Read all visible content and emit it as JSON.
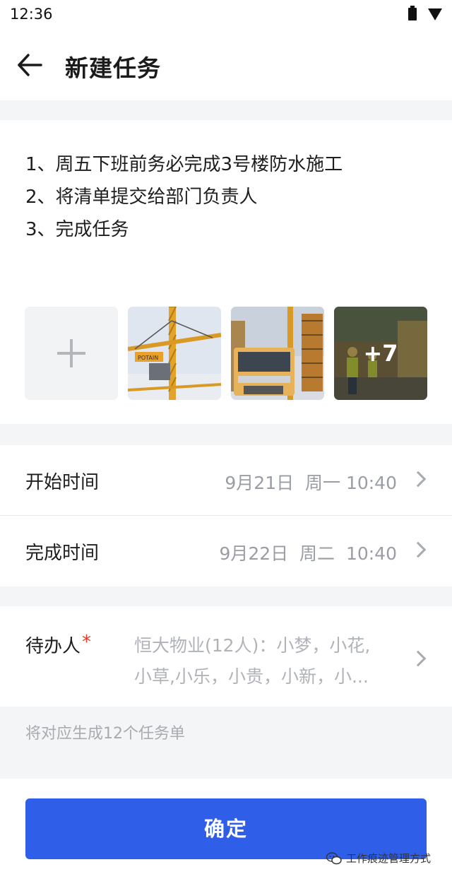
{
  "status_bar": {
    "time": "12:36"
  },
  "header": {
    "title": "新建任务"
  },
  "task": {
    "lines": [
      "1、周五下班前务必完成3号楼防水施工",
      "2、将清单提交给部门负责人",
      "3、完成任务"
    ]
  },
  "attachments": {
    "more_count": "+7"
  },
  "schedule": {
    "start_label": "开始时间",
    "start_value": "9月21日  周一 10:40",
    "end_label": "完成时间",
    "end_value": "9月22日  周二  10:40"
  },
  "assignee": {
    "label": "待办人",
    "required_mark": "*",
    "value_line1": "恒大物业(12人)：小梦，小花,",
    "value_line2": "小草,小乐，小贵，小新，小..."
  },
  "note": "将对应生成12个任务单",
  "confirm_label": "确定",
  "watermark": "工作痕迹管理方式",
  "colors": {
    "primary": "#2f5fe8",
    "required": "#e03a2f",
    "muted": "#9a9da3"
  }
}
